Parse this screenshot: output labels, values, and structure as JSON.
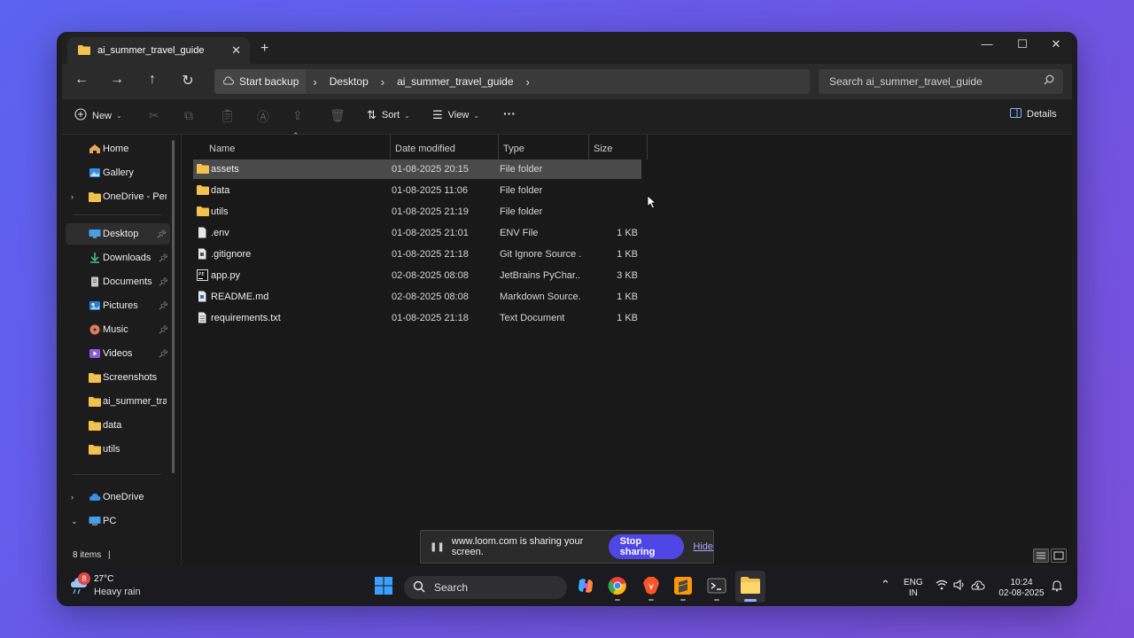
{
  "window": {
    "tab_title": "ai_summer_travel_guide",
    "tab_close": "✕",
    "new_tab": "+",
    "minimize": "—",
    "maximize": "☐",
    "close": "✕"
  },
  "address": {
    "backup_label": "Start backup",
    "breadcrumbs": [
      "Desktop",
      "ai_summer_travel_guide"
    ],
    "search_placeholder": "Search ai_summer_travel_guide"
  },
  "toolbar": {
    "new_label": "New",
    "sort_label": "Sort",
    "view_label": "View",
    "more_label": "···",
    "details_label": "Details"
  },
  "sidebar": {
    "items": [
      {
        "label": "Home",
        "icon": "home-icon"
      },
      {
        "label": "Gallery",
        "icon": "gallery-icon"
      },
      {
        "label": "OneDrive - Personal",
        "icon": "folder-icon"
      },
      {
        "label": "Desktop",
        "icon": "desktop-icon"
      },
      {
        "label": "Downloads",
        "icon": "download-icon"
      },
      {
        "label": "Documents",
        "icon": "document-icon"
      },
      {
        "label": "Pictures",
        "icon": "pictures-icon"
      },
      {
        "label": "Music",
        "icon": "music-icon"
      },
      {
        "label": "Videos",
        "icon": "video-icon"
      },
      {
        "label": "Screenshots",
        "icon": "folder-icon"
      },
      {
        "label": "ai_summer_travel_guide",
        "icon": "folder-icon"
      },
      {
        "label": "data",
        "icon": "folder-icon"
      },
      {
        "label": "utils",
        "icon": "folder-icon"
      },
      {
        "label": "OneDrive",
        "icon": "cloud-icon"
      },
      {
        "label": "PC",
        "icon": "pc-icon"
      }
    ]
  },
  "columns": {
    "name": "Name",
    "date": "Date modified",
    "type": "Type",
    "size": "Size"
  },
  "files": [
    {
      "name": "assets",
      "date": "01-08-2025 20:15",
      "type": "File folder",
      "size": "",
      "icon": "folder"
    },
    {
      "name": "data",
      "date": "01-08-2025 11:06",
      "type": "File folder",
      "size": "",
      "icon": "folder"
    },
    {
      "name": "utils",
      "date": "01-08-2025 21:19",
      "type": "File folder",
      "size": "",
      "icon": "folder"
    },
    {
      "name": ".env",
      "date": "01-08-2025 21:01",
      "type": "ENV File",
      "size": "1 KB",
      "icon": "file"
    },
    {
      "name": ".gitignore",
      "date": "01-08-2025 21:18",
      "type": "Git Ignore Source ...",
      "size": "1 KB",
      "icon": "file"
    },
    {
      "name": "app.py",
      "date": "02-08-2025 08:08",
      "type": "JetBrains PyChar...",
      "size": "3 KB",
      "icon": "pyfile"
    },
    {
      "name": "README.md",
      "date": "02-08-2025 08:08",
      "type": "Markdown Source...",
      "size": "1 KB",
      "icon": "file"
    },
    {
      "name": "requirements.txt",
      "date": "01-08-2025 21:18",
      "type": "Text Document",
      "size": "1 KB",
      "icon": "file"
    }
  ],
  "status": {
    "item_count": "8 items",
    "divider": "|"
  },
  "loom": {
    "message": "www.loom.com is sharing your screen.",
    "stop_label": "Stop sharing",
    "hide_label": "Hide"
  },
  "taskbar": {
    "weather_temp": "27°C",
    "weather_desc": "Heavy rain",
    "weather_badge": "8",
    "search_label": "Search",
    "lang_top": "ENG",
    "lang_bottom": "IN",
    "time": "10:24",
    "date": "02-08-2025"
  },
  "colors": {
    "accent": "#4f46e5",
    "folder": "#f2c14e",
    "background_gradient_start": "#5b63f0",
    "background_gradient_end": "#7a4fd8"
  }
}
